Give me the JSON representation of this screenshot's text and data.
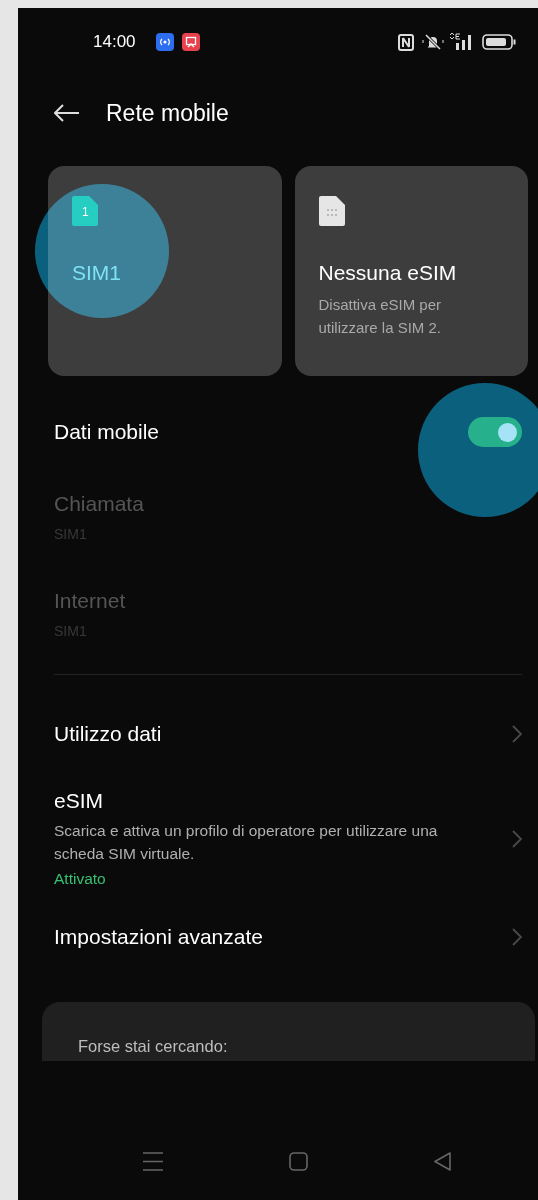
{
  "status_bar": {
    "time": "14:00"
  },
  "header": {
    "title": "Rete mobile"
  },
  "sim_cards": [
    {
      "kind": "sim",
      "badge": "1",
      "title": "SIM1"
    },
    {
      "kind": "esim",
      "title": "Nessuna eSIM",
      "subtitle": "Disattiva eSIM per utilizzare la SIM 2."
    }
  ],
  "mobile_data": {
    "label": "Dati mobile",
    "on": true
  },
  "sim_preferences": [
    {
      "label": "Chiamata",
      "value": "SIM1",
      "disabled": true
    },
    {
      "label": "Internet",
      "value": "SIM1",
      "disabled": true
    }
  ],
  "menu": [
    {
      "title": "Utilizzo dati"
    },
    {
      "title": "eSIM",
      "description": "Scarica e attiva un profilo di operatore per utilizzare una scheda SIM virtuale.",
      "status": "Attivato"
    },
    {
      "title": "Impostazioni avanzate"
    }
  ],
  "suggestions": {
    "title": "Forse stai cercando:"
  }
}
